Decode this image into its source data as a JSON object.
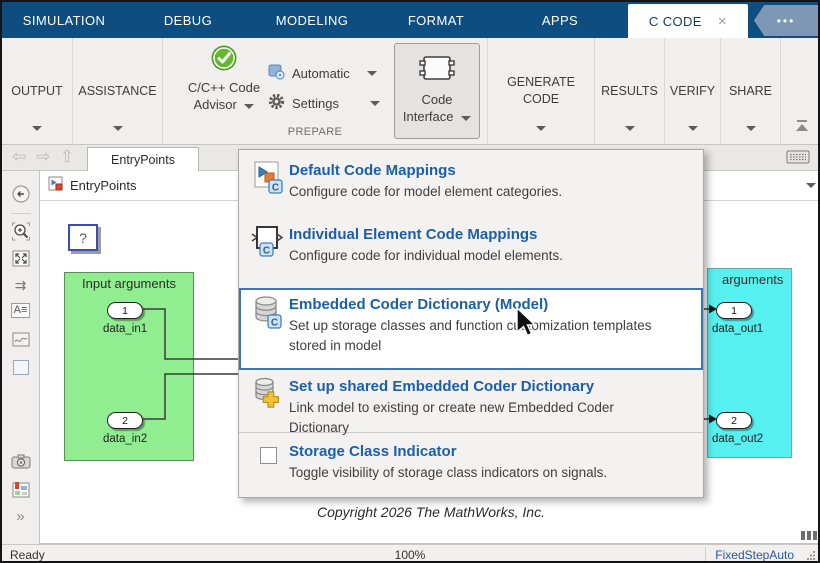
{
  "tab_bar": {
    "tabs": [
      "SIMULATION",
      "DEBUG",
      "MODELING",
      "FORMAT",
      "APPS"
    ],
    "active_tab": "C CODE"
  },
  "icons": {
    "close": "×",
    "ellipsis": "•••",
    "back": "⇦",
    "forward": "⇨",
    "up": "⇧",
    "signal_routing": "⇉",
    "annotation": "A≡",
    "expand": "»"
  },
  "toolbar": {
    "output": "OUTPUT",
    "assistance": "ASSISTANCE",
    "code_advisor_line1": "C/C++ Code",
    "code_advisor_line2": "Advisor",
    "automatic": "Automatic",
    "settings": "Settings",
    "prepare_section": "PREPARE",
    "code_interface_line1": "Code",
    "code_interface_line2": "Interface",
    "generate_line1": "GENERATE",
    "generate_line2": "CODE",
    "results": "RESULTS",
    "verify": "VERIFY",
    "share": "SHARE"
  },
  "nav": {
    "document_tab": "EntryPoints",
    "breadcrumb": "EntryPoints"
  },
  "menu": {
    "items": [
      {
        "title": "Default Code Mappings",
        "desc": "Configure code for model element categories."
      },
      {
        "title": "Individual Element Code Mappings",
        "desc": "Configure code for individual model elements."
      },
      {
        "title": "Embedded Coder Dictionary (Model)",
        "desc": "Set up storage classes and function customization templates stored in model",
        "highlighted": true
      },
      {
        "title": "Set up shared Embedded Coder Dictionary",
        "desc": "Link model to existing or create new Embedded Coder Dictionary"
      },
      {
        "title": "Storage Class Indicator",
        "desc": "Toggle visibility of storage class indicators on signals.",
        "checked": false
      }
    ]
  },
  "canvas": {
    "unknown_block": "?",
    "input_block": {
      "title": "Input arguments",
      "ports": [
        {
          "num": "1",
          "label": "data_in1"
        },
        {
          "num": "2",
          "label": "data_in2"
        }
      ]
    },
    "output_block": {
      "title": "arguments",
      "ports": [
        {
          "num": "1",
          "label": "data_out1"
        },
        {
          "num": "2",
          "label": "data_out2"
        }
      ]
    },
    "copyright": "Copyright 2026 The MathWorks, Inc."
  },
  "status_bar": {
    "left": "Ready",
    "zoom": "100%",
    "solver": "FixedStepAuto"
  },
  "colors": {
    "tab_bar_blue": "#0d4d7f",
    "menu_title_blue": "#1b5faa",
    "highlight_border": "#3a77b8",
    "input_block_green": "#90ee90",
    "output_block_cyan": "#57f0f0",
    "solver_link_blue": "#2b54a3",
    "overflow_button": "#7e97b4"
  }
}
